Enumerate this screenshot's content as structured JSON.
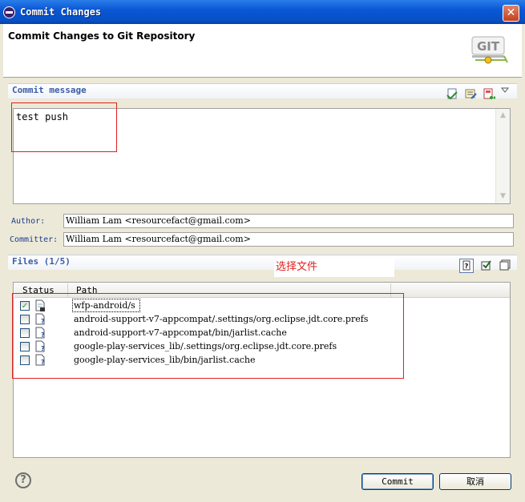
{
  "window": {
    "title": "Commit Changes",
    "close_glyph": "✕"
  },
  "banner": {
    "title": "Commit Changes to Git Repository",
    "logo_text": "GIT"
  },
  "commit_message": {
    "section_label": "Commit message",
    "text": "test push"
  },
  "author": {
    "label": "Author:",
    "value": "William Lam <resourcefact@gmail.com>"
  },
  "committer": {
    "label": "Committer:",
    "value": "William Lam <resourcefact@gmail.com>"
  },
  "files": {
    "section_label": "Files (1/5)",
    "annotation": "选择文件",
    "columns": [
      "Status",
      "Path"
    ],
    "rows": [
      {
        "checked": true,
        "path": "wfp-android/s"
      },
      {
        "checked": false,
        "path": "android-support-v7-appcompat/.settings/org.eclipse.jdt.core.prefs"
      },
      {
        "checked": false,
        "path": "android-support-v7-appcompat/bin/jarlist.cache"
      },
      {
        "checked": false,
        "path": "google-play-services_lib/.settings/org.eclipse.jdt.core.prefs"
      },
      {
        "checked": false,
        "path": "google-play-services_lib/bin/jarlist.cache"
      }
    ]
  },
  "buttons": {
    "commit": "Commit",
    "cancel": "取消",
    "help_glyph": "?"
  },
  "icons": {
    "toolbar": [
      "add-signed-off-icon",
      "amend-icon",
      "compute-changeid-icon",
      "view-menu-icon"
    ],
    "files_toolbar": [
      "untracked-toggle-icon",
      "select-all-icon",
      "deselect-all-icon"
    ]
  },
  "colors": {
    "title_bar": "#0a58d6",
    "section_label": "#3a5ca8",
    "annotation": "#e02020"
  }
}
